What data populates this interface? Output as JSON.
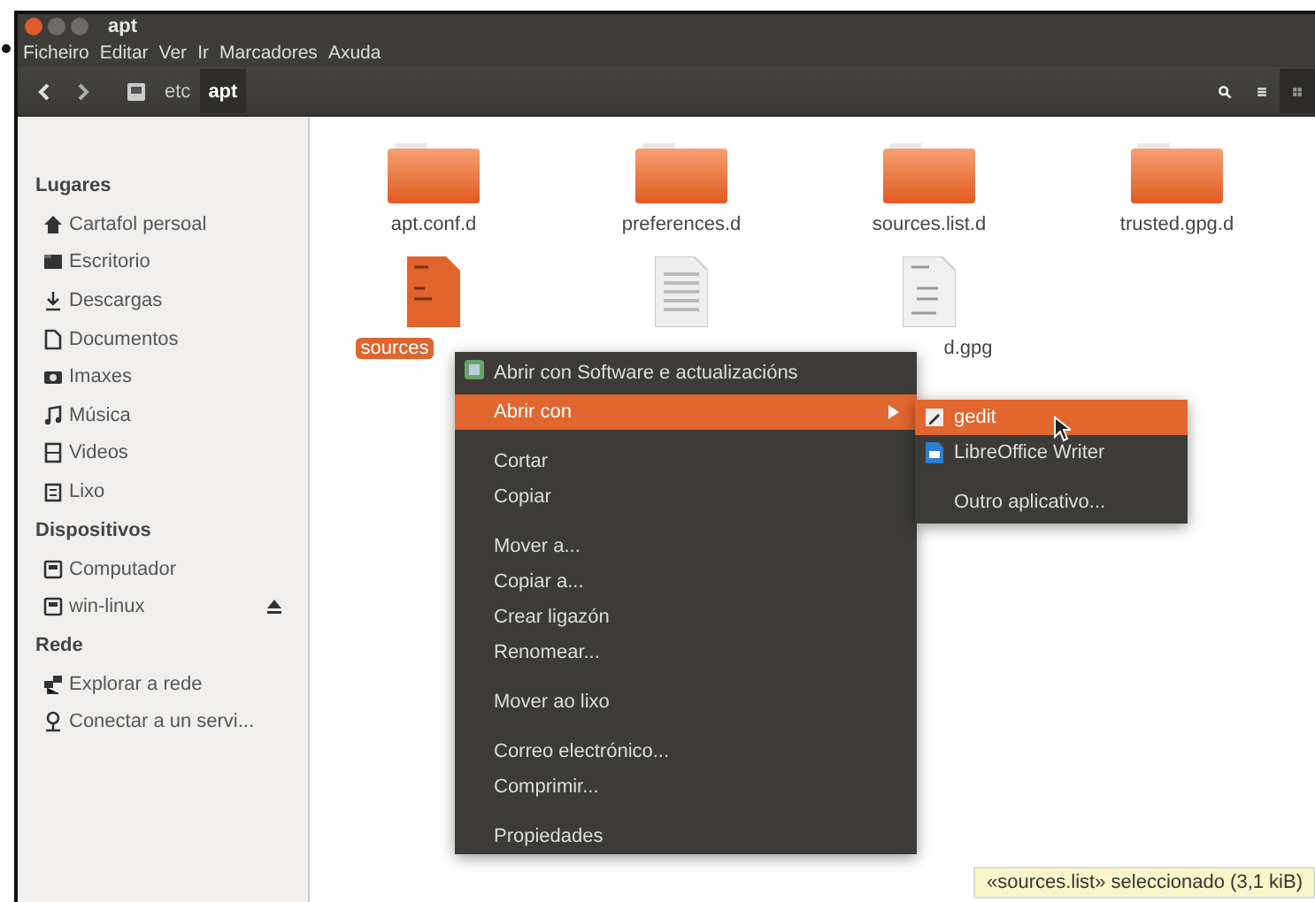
{
  "window": {
    "title": "apt"
  },
  "menubar": [
    "Ficheiro",
    "Editar",
    "Ver",
    "Ir",
    "Marcadores",
    "Axuda"
  ],
  "toolbar": {
    "path": [
      {
        "label": "etc",
        "selected": false
      },
      {
        "label": "apt",
        "selected": true
      }
    ],
    "views": [
      {
        "kind": "list",
        "selected": false
      },
      {
        "kind": "grid",
        "selected": true
      }
    ]
  },
  "sidebar": [
    {
      "heading": "Lugares",
      "items": [
        {
          "label": "Cartafol persoal",
          "eject": false
        },
        {
          "label": "Escritorio",
          "eject": false
        },
        {
          "label": "Descargas",
          "eject": false
        },
        {
          "label": "Documentos",
          "eject": false
        },
        {
          "label": "Imaxes",
          "eject": false
        },
        {
          "label": "Música",
          "eject": false
        },
        {
          "label": "Videos",
          "eject": false
        },
        {
          "label": "Lixo",
          "eject": false
        }
      ]
    },
    {
      "heading": "Dispositivos",
      "items": [
        {
          "label": "Computador",
          "eject": false
        },
        {
          "label": "win-linux",
          "eject": true
        }
      ]
    },
    {
      "heading": "Rede",
      "items": [
        {
          "label": "Explorar a rede",
          "eject": false
        },
        {
          "label": "Conectar a un servi...",
          "eject": false
        }
      ]
    }
  ],
  "files": [
    {
      "name": "apt.conf.d",
      "kind": "folder",
      "selected": false
    },
    {
      "name": "preferences.d",
      "kind": "folder",
      "selected": false
    },
    {
      "name": "sources.list.d",
      "kind": "folder",
      "selected": false
    },
    {
      "name": "trusted.gpg.d",
      "kind": "folder",
      "selected": false
    },
    {
      "name": "sources",
      "kind": "text",
      "selected": true
    },
    {
      "kind": "plain",
      "selected": false
    },
    {
      "name": "d.gpg",
      "kind": "key",
      "selected": false
    }
  ],
  "context_menu": [
    {
      "kind": "app",
      "label": "Abrir con Software e actualizacións",
      "selected": false
    },
    {
      "kind": "submenu",
      "label": "Abrir con",
      "selected": true
    },
    {
      "kind": "separator"
    },
    {
      "kind": "item",
      "label": "Cortar",
      "selected": false
    },
    {
      "kind": "item",
      "label": "Copiar",
      "selected": false
    },
    {
      "kind": "separator"
    },
    {
      "kind": "item",
      "label": "Mover a...",
      "selected": false
    },
    {
      "kind": "item",
      "label": "Copiar a...",
      "selected": false
    },
    {
      "kind": "item",
      "label": "Crear ligazón",
      "selected": false
    },
    {
      "kind": "item",
      "label": "Renomear...",
      "selected": false
    },
    {
      "kind": "separator"
    },
    {
      "kind": "item",
      "label": "Mover ao lixo",
      "selected": false
    },
    {
      "kind": "separator"
    },
    {
      "kind": "item",
      "label": "Correo electrónico...",
      "selected": false
    },
    {
      "kind": "item",
      "label": "Comprimir...",
      "selected": false
    },
    {
      "kind": "separator"
    },
    {
      "kind": "item",
      "label": "Propiedades",
      "selected": false
    }
  ],
  "submenu": [
    {
      "kind": "app",
      "label": "gedit",
      "selected": true
    },
    {
      "kind": "app",
      "label": "LibreOffice Writer",
      "selected": false
    },
    {
      "kind": "separator"
    },
    {
      "kind": "item",
      "label": "Outro aplicativo...",
      "selected": false
    }
  ],
  "status": "«sources.list» seleccionado (3,1 kiB)"
}
